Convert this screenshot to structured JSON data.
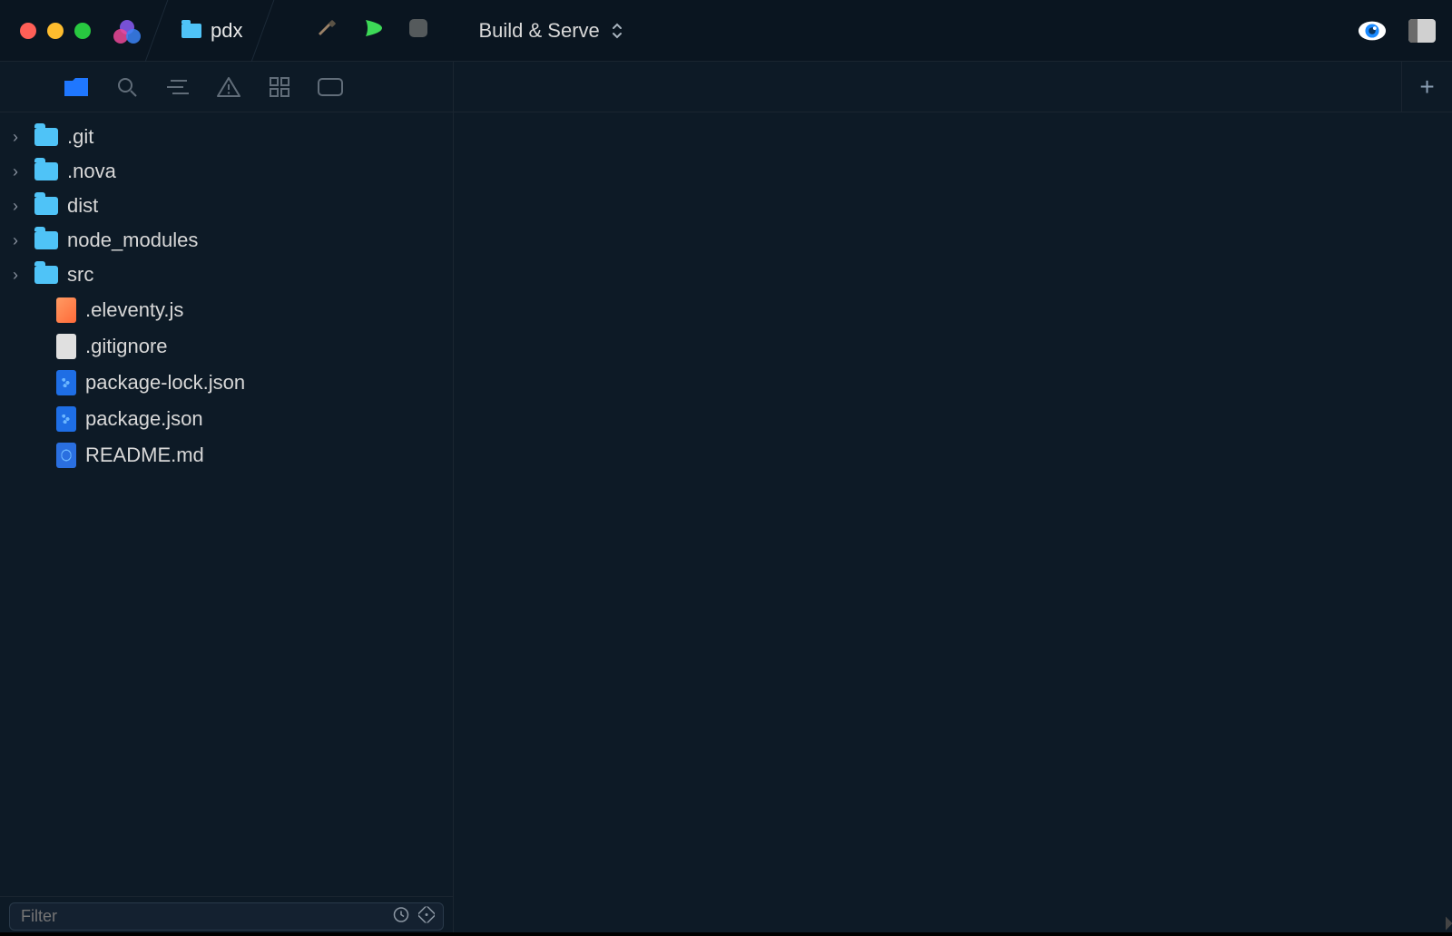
{
  "titlebar": {
    "project_name": "pdx",
    "scheme": "Build & Serve"
  },
  "sidebar": {
    "items": [
      {
        "name": ".git",
        "type": "folder",
        "expandable": true
      },
      {
        "name": ".nova",
        "type": "folder",
        "expandable": true
      },
      {
        "name": "dist",
        "type": "folder",
        "expandable": true
      },
      {
        "name": "node_modules",
        "type": "folder",
        "expandable": true
      },
      {
        "name": "src",
        "type": "folder",
        "expandable": true
      },
      {
        "name": ".eleventy.js",
        "type": "file",
        "icon": "js",
        "expandable": false
      },
      {
        "name": ".gitignore",
        "type": "file",
        "icon": "plain",
        "expandable": false
      },
      {
        "name": "package-lock.json",
        "type": "file",
        "icon": "json",
        "expandable": false
      },
      {
        "name": "package.json",
        "type": "file",
        "icon": "json",
        "expandable": false
      },
      {
        "name": "README.md",
        "type": "file",
        "icon": "md",
        "expandable": false
      }
    ],
    "filter_placeholder": "Filter"
  }
}
